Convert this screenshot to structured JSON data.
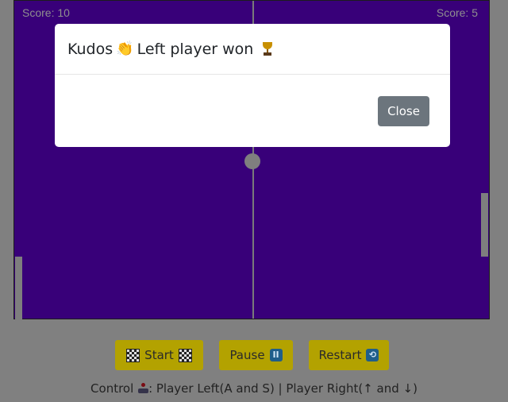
{
  "scores": {
    "left": "Score: 10",
    "right": "Score: 5"
  },
  "modal": {
    "title_prefix": "Kudos",
    "title_text": "Left player won",
    "close_label": "Close"
  },
  "controls": {
    "start_label": "Start",
    "pause_label": "Pause",
    "pause_icon": "II",
    "restart_label": "Restart",
    "restart_icon": "⟲"
  },
  "help": {
    "prefix": "Control",
    "text": ": Player Left(A and S) | Player Right(↑ and ↓)"
  },
  "colors": {
    "board": "#380079",
    "button": "#b3a200",
    "close_button": "#6c757d"
  },
  "icons": [
    "clapping-hands-icon",
    "trophy-icon",
    "checkered-flag-icon",
    "pause-icon",
    "restart-icon",
    "joystick-icon"
  ]
}
